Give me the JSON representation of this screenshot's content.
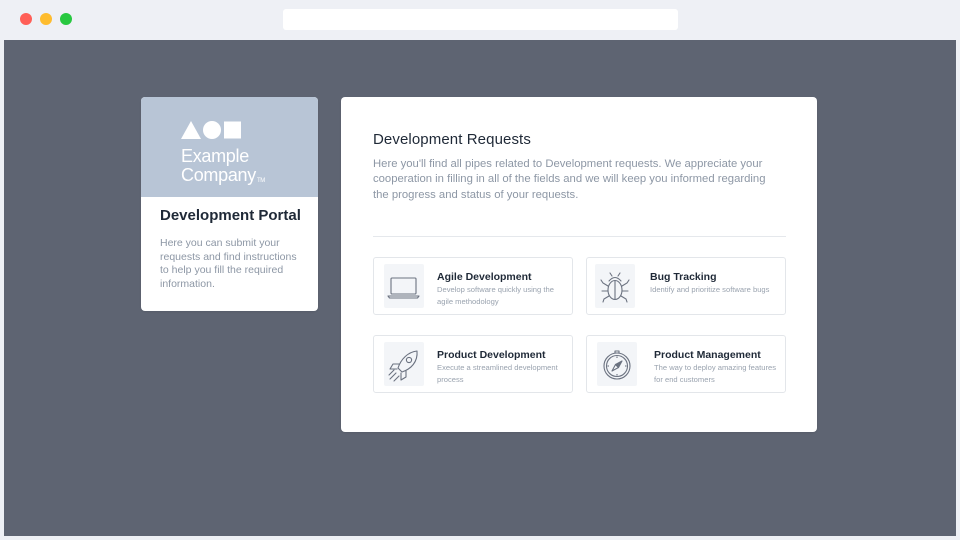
{
  "brand": {
    "logo_line1": "Example",
    "logo_line2": "Company",
    "logo_tm": "TM",
    "banner_color": "#b8c5d6"
  },
  "portal": {
    "title": "Development Portal",
    "description": "Here you can submit your requests and find instructions to help you fill the required information."
  },
  "requests": {
    "title": "Development Requests",
    "description": "Here you'll find all pipes related to Development requests. We appreciate your cooperation in filling in all of the fields and we will keep you informed regarding the progress and status of your requests.",
    "tiles": [
      {
        "icon": "laptop-icon",
        "title": "Agile Development",
        "description": "Develop software quickly using the agile methodology"
      },
      {
        "icon": "bug-icon",
        "title": "Bug Tracking",
        "description": "Identify and prioritize software bugs"
      },
      {
        "icon": "rocket-icon",
        "title": "Product Development",
        "description": "Execute a streamlined development process"
      },
      {
        "icon": "compass-icon",
        "title": "Product Management",
        "description": "The way to deploy amazing features for end customers"
      }
    ]
  },
  "colors": {
    "viewport_bg": "#5e6472",
    "window_chrome": "#eef0f5",
    "close": "#ff5f57",
    "minimize": "#febc2e",
    "maximize": "#28c840"
  }
}
